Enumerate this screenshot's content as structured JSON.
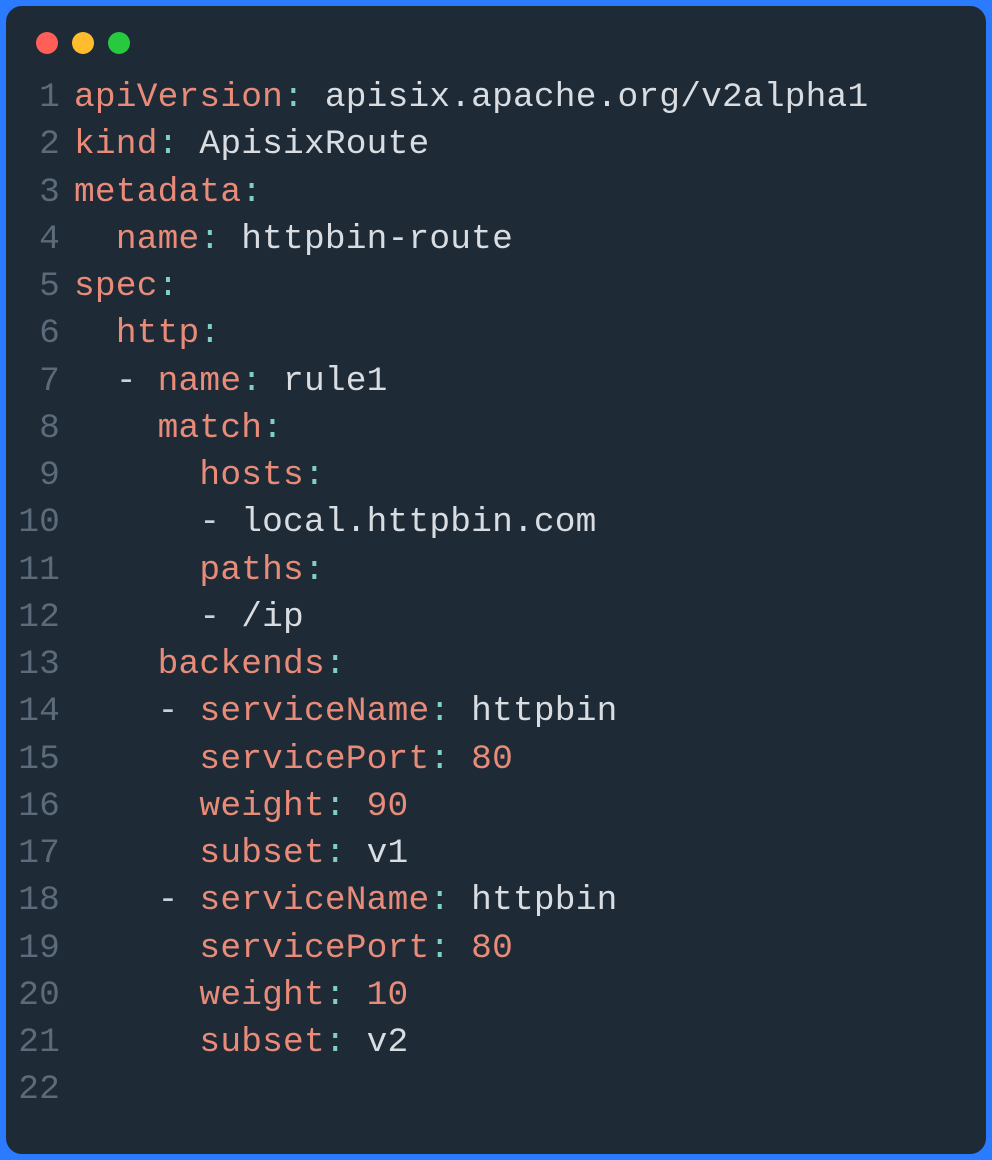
{
  "titlebar": {
    "buttons": [
      "close",
      "minimize",
      "zoom"
    ]
  },
  "code": {
    "language": "yaml",
    "line_count": 22,
    "line_numbers": [
      "1",
      "2",
      "3",
      "4",
      "5",
      "6",
      "7",
      "8",
      "9",
      "10",
      "11",
      "12",
      "13",
      "14",
      "15",
      "16",
      "17",
      "18",
      "19",
      "20",
      "21",
      "22"
    ],
    "tokens": [
      [
        {
          "t": "k",
          "v": "apiVersion"
        },
        {
          "t": "p",
          "v": ":"
        },
        {
          "t": "w",
          "v": " apisix.apache.org/v2alpha1"
        }
      ],
      [
        {
          "t": "k",
          "v": "kind"
        },
        {
          "t": "p",
          "v": ":"
        },
        {
          "t": "w",
          "v": " ApisixRoute"
        }
      ],
      [
        {
          "t": "k",
          "v": "metadata"
        },
        {
          "t": "p",
          "v": ":"
        }
      ],
      [
        {
          "t": "w",
          "v": "  "
        },
        {
          "t": "k",
          "v": "name"
        },
        {
          "t": "p",
          "v": ":"
        },
        {
          "t": "w",
          "v": " httpbin-route"
        }
      ],
      [
        {
          "t": "k",
          "v": "spec"
        },
        {
          "t": "p",
          "v": ":"
        }
      ],
      [
        {
          "t": "w",
          "v": "  "
        },
        {
          "t": "k",
          "v": "http"
        },
        {
          "t": "p",
          "v": ":"
        }
      ],
      [
        {
          "t": "w",
          "v": "  "
        },
        {
          "t": "d",
          "v": "-"
        },
        {
          "t": "w",
          "v": " "
        },
        {
          "t": "k",
          "v": "name"
        },
        {
          "t": "p",
          "v": ":"
        },
        {
          "t": "w",
          "v": " rule1"
        }
      ],
      [
        {
          "t": "w",
          "v": "    "
        },
        {
          "t": "k",
          "v": "match"
        },
        {
          "t": "p",
          "v": ":"
        }
      ],
      [
        {
          "t": "w",
          "v": "      "
        },
        {
          "t": "k",
          "v": "hosts"
        },
        {
          "t": "p",
          "v": ":"
        }
      ],
      [
        {
          "t": "w",
          "v": "      "
        },
        {
          "t": "d",
          "v": "-"
        },
        {
          "t": "w",
          "v": " local.httpbin.com"
        }
      ],
      [
        {
          "t": "w",
          "v": "      "
        },
        {
          "t": "k",
          "v": "paths"
        },
        {
          "t": "p",
          "v": ":"
        }
      ],
      [
        {
          "t": "w",
          "v": "      "
        },
        {
          "t": "d",
          "v": "-"
        },
        {
          "t": "w",
          "v": " /ip"
        }
      ],
      [
        {
          "t": "w",
          "v": "    "
        },
        {
          "t": "k",
          "v": "backends"
        },
        {
          "t": "p",
          "v": ":"
        }
      ],
      [
        {
          "t": "w",
          "v": "    "
        },
        {
          "t": "d",
          "v": "-"
        },
        {
          "t": "w",
          "v": " "
        },
        {
          "t": "k",
          "v": "serviceName"
        },
        {
          "t": "p",
          "v": ":"
        },
        {
          "t": "w",
          "v": " httpbin"
        }
      ],
      [
        {
          "t": "w",
          "v": "      "
        },
        {
          "t": "k",
          "v": "servicePort"
        },
        {
          "t": "p",
          "v": ":"
        },
        {
          "t": "w",
          "v": " "
        },
        {
          "t": "n",
          "v": "80"
        }
      ],
      [
        {
          "t": "w",
          "v": "      "
        },
        {
          "t": "k",
          "v": "weight"
        },
        {
          "t": "p",
          "v": ":"
        },
        {
          "t": "w",
          "v": " "
        },
        {
          "t": "n",
          "v": "90"
        }
      ],
      [
        {
          "t": "w",
          "v": "      "
        },
        {
          "t": "k",
          "v": "subset"
        },
        {
          "t": "p",
          "v": ":"
        },
        {
          "t": "w",
          "v": " v1"
        }
      ],
      [
        {
          "t": "w",
          "v": "    "
        },
        {
          "t": "d",
          "v": "-"
        },
        {
          "t": "w",
          "v": " "
        },
        {
          "t": "k",
          "v": "serviceName"
        },
        {
          "t": "p",
          "v": ":"
        },
        {
          "t": "w",
          "v": " httpbin"
        }
      ],
      [
        {
          "t": "w",
          "v": "      "
        },
        {
          "t": "k",
          "v": "servicePort"
        },
        {
          "t": "p",
          "v": ":"
        },
        {
          "t": "w",
          "v": " "
        },
        {
          "t": "n",
          "v": "80"
        }
      ],
      [
        {
          "t": "w",
          "v": "      "
        },
        {
          "t": "k",
          "v": "weight"
        },
        {
          "t": "p",
          "v": ":"
        },
        {
          "t": "w",
          "v": " "
        },
        {
          "t": "n",
          "v": "10"
        }
      ],
      [
        {
          "t": "w",
          "v": "      "
        },
        {
          "t": "k",
          "v": "subset"
        },
        {
          "t": "p",
          "v": ":"
        },
        {
          "t": "w",
          "v": " v2"
        }
      ],
      []
    ],
    "parsed_yaml": {
      "apiVersion": "apisix.apache.org/v2alpha1",
      "kind": "ApisixRoute",
      "metadata": {
        "name": "httpbin-route"
      },
      "spec": {
        "http": [
          {
            "name": "rule1",
            "match": {
              "hosts": [
                "local.httpbin.com"
              ],
              "paths": [
                "/ip"
              ]
            },
            "backends": [
              {
                "serviceName": "httpbin",
                "servicePort": 80,
                "weight": 90,
                "subset": "v1"
              },
              {
                "serviceName": "httpbin",
                "servicePort": 80,
                "weight": 10,
                "subset": "v2"
              }
            ]
          }
        ]
      }
    }
  }
}
